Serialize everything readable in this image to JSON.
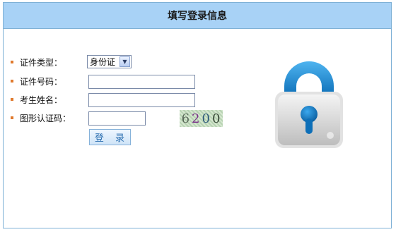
{
  "header": {
    "title": "填写登录信息"
  },
  "form": {
    "id_type_label": "证件类型：",
    "id_type_value": "身份证",
    "id_number_label": "证件号码：",
    "id_number_value": "",
    "name_label": "考生姓名：",
    "name_value": "",
    "captcha_label": "图形认证码：",
    "captcha_value": "",
    "captcha_digits": [
      "6",
      "2",
      "0",
      "0"
    ],
    "login_label": "登 录"
  },
  "icons": {
    "lock": "lock-icon"
  },
  "colors": {
    "header_bg": "#a8d2f6",
    "border": "#7fb1d6",
    "bullet": "#e07a2e",
    "lock_shackle": "#1e8ad6"
  }
}
